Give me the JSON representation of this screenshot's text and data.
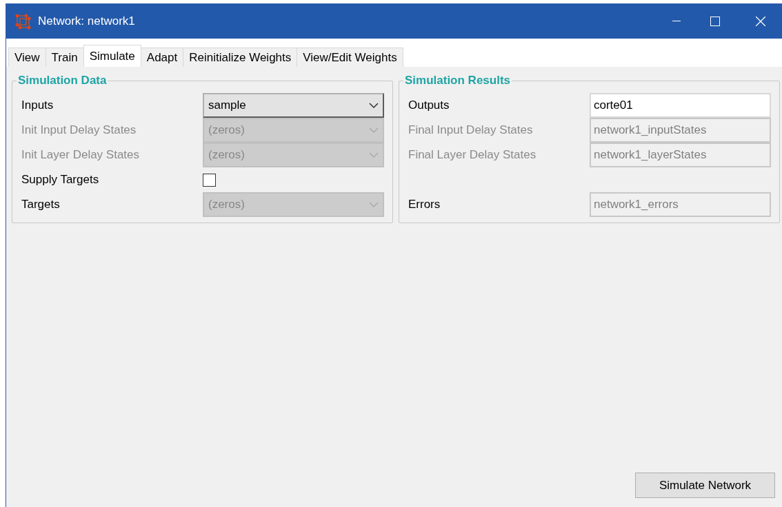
{
  "window": {
    "title": "Network: network1"
  },
  "tabs": [
    {
      "label": "View",
      "selected": false
    },
    {
      "label": "Train",
      "selected": false
    },
    {
      "label": "Simulate",
      "selected": true
    },
    {
      "label": "Adapt",
      "selected": false
    },
    {
      "label": "Reinitialize Weights",
      "selected": false
    },
    {
      "label": "View/Edit Weights",
      "selected": false
    }
  ],
  "simulation_data": {
    "title": "Simulation Data",
    "rows": [
      {
        "kind": "dropdown",
        "label": "Inputs",
        "value": "sample",
        "disabled": false,
        "label_disabled": false
      },
      {
        "kind": "dropdown",
        "label": "Init Input Delay States",
        "value": "(zeros)",
        "disabled": true,
        "label_disabled": true
      },
      {
        "kind": "dropdown",
        "label": "Init Layer Delay States",
        "value": "(zeros)",
        "disabled": true,
        "label_disabled": true
      },
      {
        "kind": "checkbox",
        "label": "Supply Targets",
        "checked": false,
        "label_disabled": false
      },
      {
        "kind": "dropdown",
        "label": "Targets",
        "value": "(zeros)",
        "disabled": true,
        "label_disabled": false
      }
    ]
  },
  "simulation_results": {
    "title": "Simulation Results",
    "rows": [
      {
        "label": "Outputs",
        "value": "corte01",
        "disabled": false,
        "label_disabled": false
      },
      {
        "label": "Final Input Delay States",
        "value": "network1_inputStates",
        "disabled": true,
        "label_disabled": true
      },
      {
        "label": "Final Layer Delay States",
        "value": "network1_layerStates",
        "disabled": true,
        "label_disabled": true
      },
      {
        "label": "Errors",
        "value": "network1_errors",
        "disabled": true,
        "label_disabled": false
      }
    ]
  },
  "buttons": [
    {
      "label": "Simulate Network"
    }
  ]
}
